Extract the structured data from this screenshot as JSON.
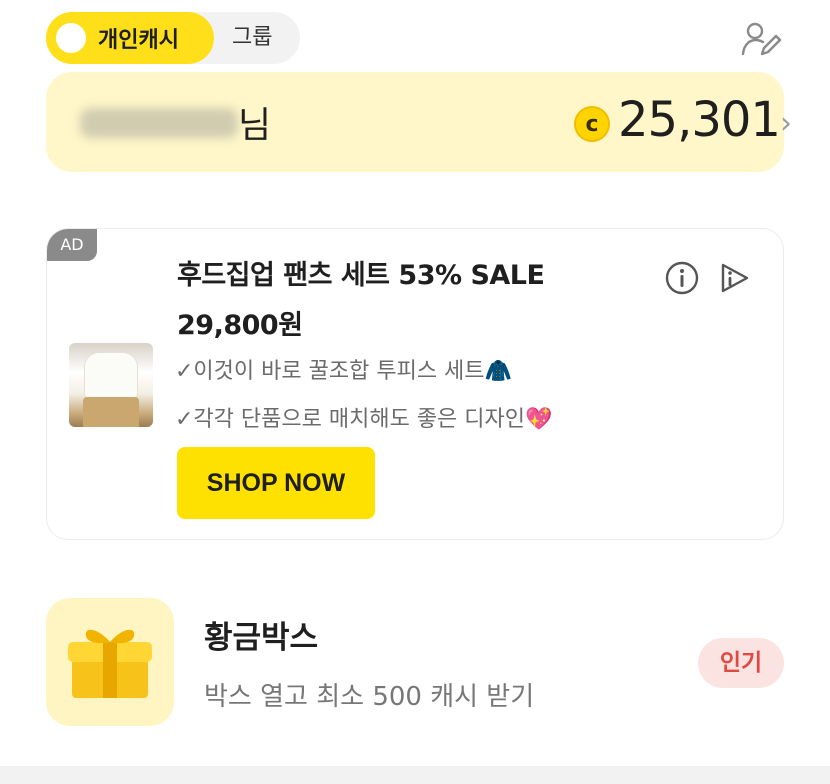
{
  "toggle": {
    "active_label": "개인캐시",
    "inactive_label": "그룹"
  },
  "balance": {
    "name_suffix": "님",
    "coin_symbol": "c",
    "amount": "25,301",
    "chevron": "›"
  },
  "ad": {
    "tag": "AD",
    "headline": "후드집업 팬츠 세트 53% SALE",
    "price": "29,800원",
    "line1": "✓이것이 바로 꿀조합 투피스 세트",
    "line1_emoji": "🧥",
    "line2": "✓각각 단품으로 매치해도 좋은 디자인",
    "line2_emoji": "💖",
    "cta": "SHOP NOW"
  },
  "golden_box": {
    "title": "황금박스",
    "description": "박스 열고 최소 500 캐시 받기",
    "badge": "인기"
  },
  "colors": {
    "brand_yellow": "#ffdf1a",
    "card_yellow": "#fff7c9",
    "badge_red": "#e04a44"
  },
  "icons": [
    "profile-edit-icon",
    "info-icon",
    "adchoices-icon",
    "gift-box-icon",
    "chevron-right-icon",
    "coin-icon"
  ]
}
